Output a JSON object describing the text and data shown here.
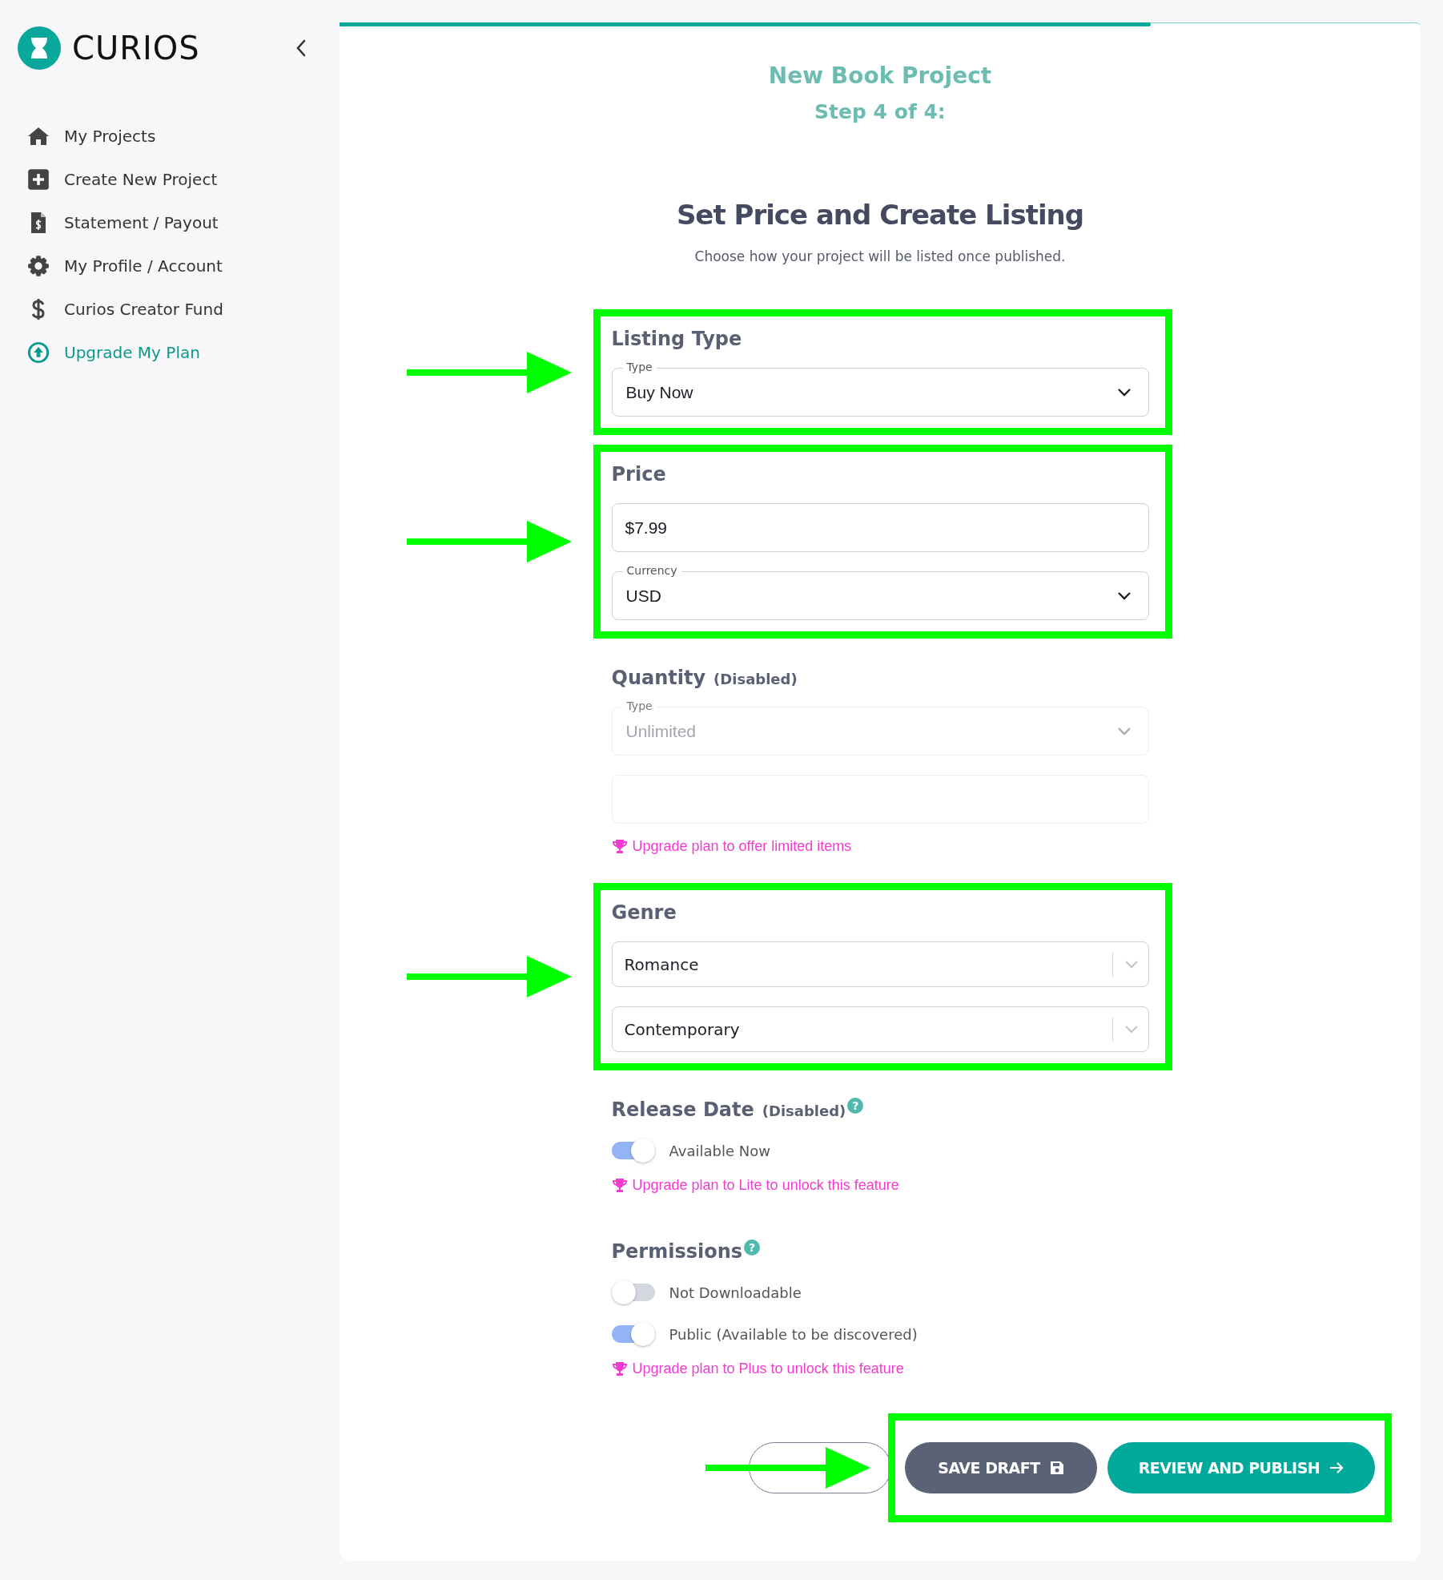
{
  "sidebar": {
    "logo": "CURIOS",
    "items": [
      {
        "label": "My Projects",
        "kind": "link"
      },
      {
        "label": "Create New Project",
        "kind": "link"
      },
      {
        "label": "Statement / Payout",
        "kind": "link"
      },
      {
        "label": "My Profile / Account",
        "kind": "link"
      },
      {
        "label": "Curios Creator Fund",
        "kind": "link"
      },
      {
        "label": "Upgrade My Plan",
        "kind": "upgrade"
      }
    ]
  },
  "progress": {
    "level": 0.75
  },
  "header": {
    "title": "New Book Project",
    "step": "Step 4 of 4:",
    "heading": "Set Price and Create Listing",
    "subtitle": "Choose how your project will be listed once published."
  },
  "sections": [
    {
      "title": "Listing Type",
      "highlighted": true,
      "fields": [
        {
          "kind": "select",
          "label": "Type",
          "value": "Buy Now",
          "disabled": false
        }
      ]
    },
    {
      "title": "Price",
      "highlighted": true,
      "fields": [
        {
          "kind": "input",
          "value": "$7.99",
          "disabled": false
        },
        {
          "kind": "select",
          "label": "Currency",
          "value": "USD",
          "disabled": false
        }
      ]
    },
    {
      "title": "Quantity",
      "note": "(Disabled)",
      "highlighted": false,
      "fields": [
        {
          "kind": "select",
          "label": "Type",
          "value": "Unlimited",
          "disabled": true
        },
        {
          "kind": "input",
          "disabled": true
        }
      ],
      "upgrade": "Upgrade plan to offer limited items"
    },
    {
      "title": "Genre",
      "highlighted": true,
      "fields": [
        {
          "kind": "combo",
          "value": "Romance",
          "disabled": false
        },
        {
          "kind": "combo",
          "value": "Contemporary",
          "disabled": false
        }
      ]
    },
    {
      "title": "Release Date",
      "note": "(Disabled)",
      "help": "?",
      "highlighted": false,
      "toggles": [
        {
          "label": "Available Now",
          "on": true
        }
      ],
      "upgrade": "Upgrade plan to Lite to unlock this feature"
    },
    {
      "title": "Permissions",
      "help": "?",
      "highlighted": false,
      "toggles": [
        {
          "label": "Not Downloadable",
          "on": false
        },
        {
          "label": "Public (Available to be discovered)",
          "on": true
        }
      ],
      "upgrade": "Upgrade plan to Plus to unlock this feature"
    }
  ],
  "actions": {
    "save": "SAVE DRAFT",
    "publish": "REVIEW AND PUBLISH",
    "highlighted": true
  }
}
